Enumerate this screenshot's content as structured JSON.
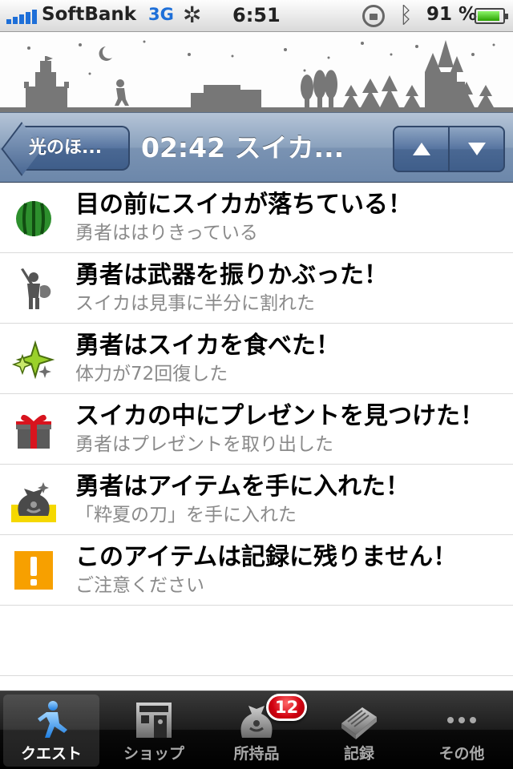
{
  "status_bar": {
    "carrier": "SoftBank",
    "network": "3G",
    "time": "6:51",
    "battery_text": "91 %",
    "battery_level": 0.91,
    "icons": [
      "signal-bars-icon",
      "activity-spinner-icon",
      "rotation-lock-icon",
      "bluetooth-icon",
      "battery-icon"
    ]
  },
  "nav": {
    "back_label": "光のほ...",
    "title": "02:42 スイカ...",
    "up_icon": "arrow-up-icon",
    "down_icon": "arrow-down-icon"
  },
  "events": [
    {
      "icon": "watermelon-icon",
      "title": "目の前にスイカが落ちている！",
      "subtitle": "勇者ははりきっている"
    },
    {
      "icon": "hero-with-sword-icon",
      "title": "勇者は武器を振りかぶった！",
      "subtitle": "スイカは見事に半分に割れた"
    },
    {
      "icon": "sparkle-icon",
      "title": "勇者はスイカを食べた！",
      "subtitle": "体力が72回復した"
    },
    {
      "icon": "gift-box-icon",
      "title": "スイカの中にプレゼントを見つけた！",
      "subtitle": "勇者はプレゼントを取り出した"
    },
    {
      "icon": "item-bag-icon",
      "title": "勇者はアイテムを手に入れた！",
      "subtitle": "「粋夏の刀」を手に入れた"
    },
    {
      "icon": "warning-exclamation-icon",
      "title": "このアイテムは記録に残りません！",
      "subtitle": "ご注意ください"
    }
  ],
  "tabs": [
    {
      "label": "クエスト",
      "icon": "running-hero-icon",
      "active": true
    },
    {
      "label": "ショップ",
      "icon": "shop-icon",
      "active": false
    },
    {
      "label": "所持品",
      "icon": "bag-icon",
      "active": false,
      "badge": "12"
    },
    {
      "label": "記録",
      "icon": "book-icon",
      "active": false
    },
    {
      "label": "その他",
      "icon": "more-dots-icon",
      "active": false
    }
  ],
  "colors": {
    "nav_bar": "#7a93b3",
    "network": "#1e6fd8",
    "badge": "#d00010",
    "warning": "#f7a000"
  }
}
